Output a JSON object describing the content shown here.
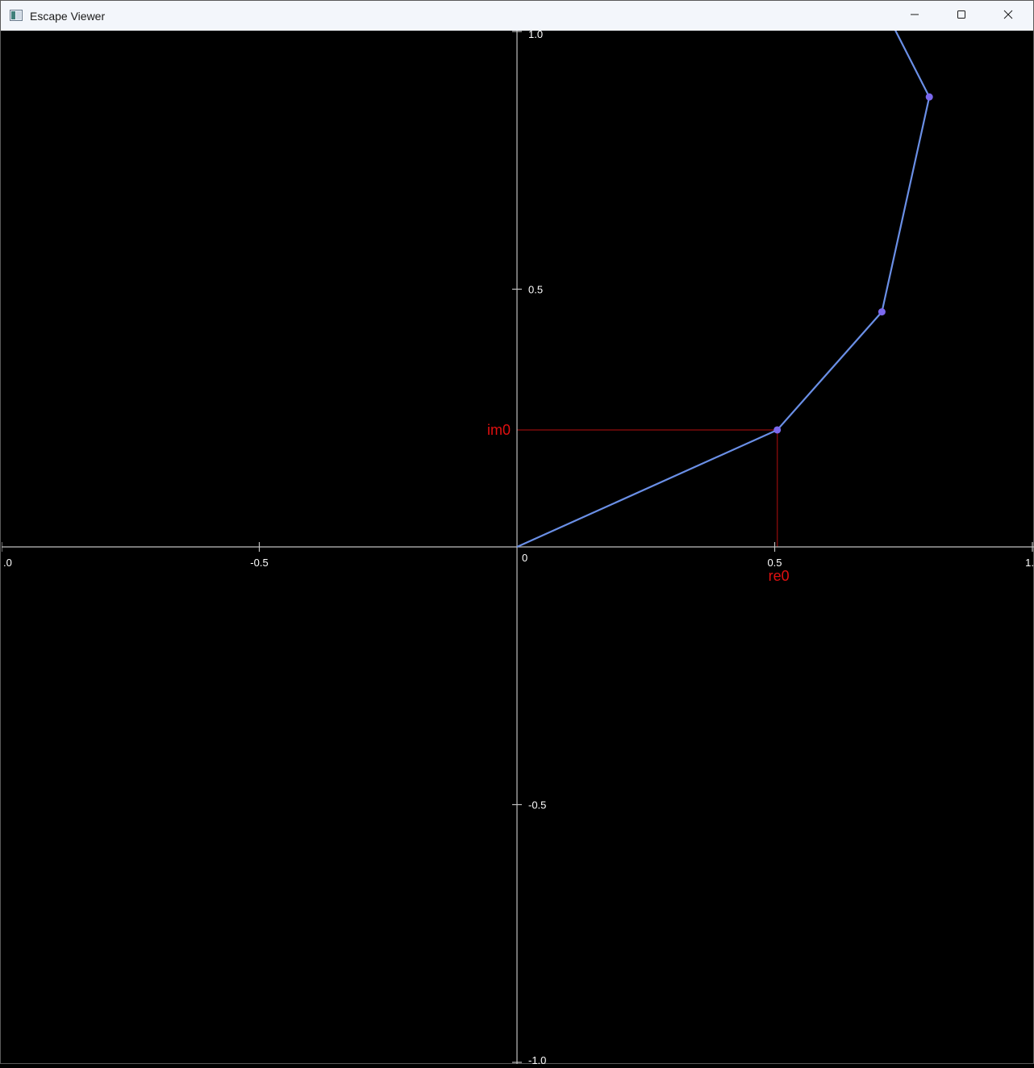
{
  "window": {
    "title": "Escape Viewer",
    "app_icon": "window-app-icon",
    "controls": {
      "minimize_icon": "minimize-icon",
      "maximize_icon": "maximize-icon",
      "close_icon": "close-icon"
    }
  },
  "chart_data": {
    "type": "line",
    "title": "",
    "xlabel": "",
    "ylabel": "",
    "xlim": [
      -1.0,
      1.0
    ],
    "ylim": [
      -1.0,
      1.0
    ],
    "grid": false,
    "x_ticks": [
      {
        "value": -1.0,
        "label": ".0"
      },
      {
        "value": -0.5,
        "label": "-0.5"
      },
      {
        "value": 0,
        "label": "0"
      },
      {
        "value": 0.5,
        "label": "0.5"
      },
      {
        "value": 1.0,
        "label": "1."
      }
    ],
    "y_ticks": [
      {
        "value": 1.0,
        "label": "1.0"
      },
      {
        "value": 0.5,
        "label": "0.5"
      },
      {
        "value": -0.5,
        "label": "-0.5"
      },
      {
        "value": -1.0,
        "label": "-1.0"
      }
    ],
    "series": [
      {
        "color": "#6a8fe6",
        "marker_color": "#7b68ee",
        "x": [
          0,
          0.505,
          0.708,
          0.8,
          0.725
        ],
        "y": [
          0,
          0.227,
          0.456,
          0.873,
          1.02
        ],
        "markers": [
          false,
          true,
          true,
          true,
          false
        ]
      }
    ],
    "annotations": {
      "color": "#e01010",
      "guide_color": "#7a0a0a",
      "point": {
        "x": 0.505,
        "y": 0.227
      },
      "re_label": "re0",
      "im_label": "im0"
    },
    "axis_color": "#bfbfbf"
  }
}
